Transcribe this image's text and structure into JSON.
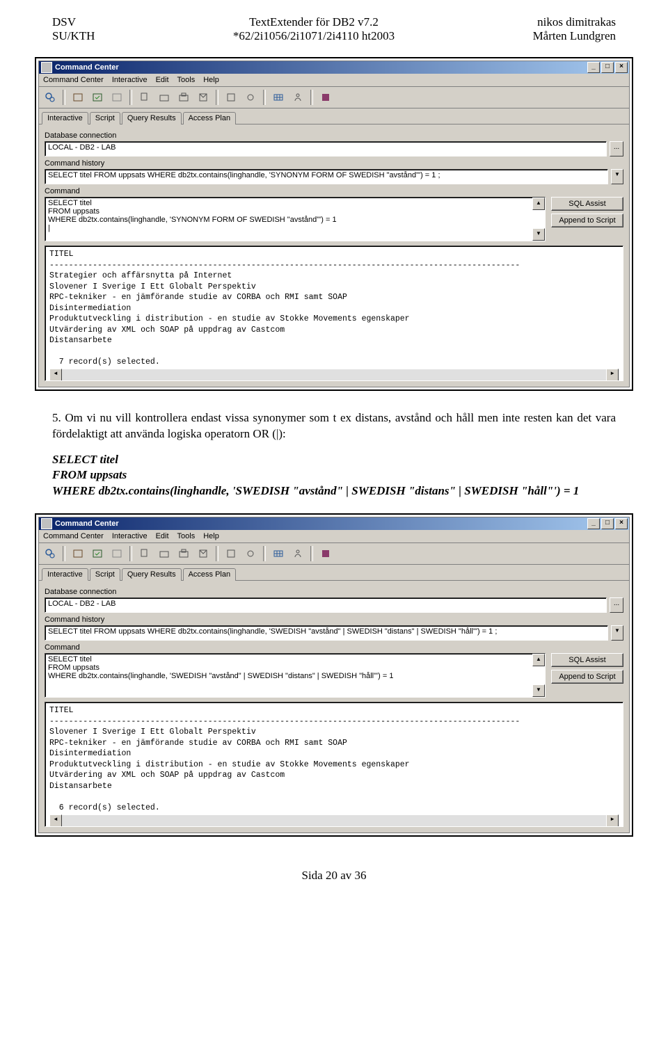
{
  "header": {
    "left1": "DSV",
    "left2": "SU/KTH",
    "center1": "TextExtender för DB2 v7.2",
    "center2": "*62/2i1056/2i1071/2i4110 ht2003",
    "right1": "nikos dimitrakas",
    "right2": "Mårten Lundgren"
  },
  "para5": "5. Om vi nu vill kontrollera endast vissa synonymer som t ex distans, avstånd och håll men inte resten kan det vara fördelaktigt att använda logiska operatorn OR (|):",
  "sql1": {
    "l1": "SELECT titel",
    "l2": "FROM uppsats",
    "l3": "WHERE db2tx.contains(linghandle, 'SWEDISH \"avstånd\" | SWEDISH \"distans\" | SWEDISH \"håll\"') = 1"
  },
  "windowTitle": "Command Center",
  "menus": [
    "Command Center",
    "Interactive",
    "Edit",
    "Tools",
    "Help"
  ],
  "tabs": [
    "Interactive",
    "Script",
    "Query Results",
    "Access Plan"
  ],
  "labels": {
    "dbconn": "Database connection",
    "history": "Command history",
    "command": "Command",
    "sqlAssist": "SQL Assist",
    "appendScript": "Append to Script",
    "ellipsis": "..."
  },
  "dbconn_value": "LOCAL - DB2 - LAB",
  "shot1": {
    "history": "SELECT titel FROM uppsats WHERE db2tx.contains(linghandle, 'SYNONYM FORM OF SWEDISH \"avstånd\"') = 1 ;",
    "command": "SELECT titel\nFROM uppsats\nWHERE db2tx.contains(linghandle, 'SYNONYM FORM OF SWEDISH \"avstånd\"') = 1\n|",
    "result": "TITEL\n--------------------------------------------------------------------------------------------------\nStrategier och affärsnytta på Internet\nSlovener I Sverige I Ett Globalt Perspektiv\nRPC-tekniker - en jämförande studie av CORBA och RMI samt SOAP\nDisintermediation\nProduktutveckling i distribution - en studie av Stokke Movements egenskaper\nUtvärdering av XML och SOAP på uppdrag av Castcom\nDistansarbete\n\n  7 record(s) selected.\n"
  },
  "shot2": {
    "history": "SELECT titel FROM uppsats WHERE db2tx.contains(linghandle, 'SWEDISH \"avstånd\" | SWEDISH \"distans\" | SWEDISH \"håll\"') = 1 ;",
    "command": "SELECT titel\nFROM uppsats\nWHERE db2tx.contains(linghandle, 'SWEDISH \"avstånd\" | SWEDISH \"distans\" | SWEDISH \"håll\"') = 1",
    "result": "TITEL\n--------------------------------------------------------------------------------------------------\nSlovener I Sverige I Ett Globalt Perspektiv\nRPC-tekniker - en jämförande studie av CORBA och RMI samt SOAP\nDisintermediation\nProduktutveckling i distribution - en studie av Stokke Movements egenskaper\nUtvärdering av XML och SOAP på uppdrag av Castcom\nDistansarbete\n\n  6 record(s) selected.\n"
  },
  "footer": "Sida 20 av 36",
  "winbtns": {
    "min": "_",
    "max": "□",
    "close": "×"
  }
}
